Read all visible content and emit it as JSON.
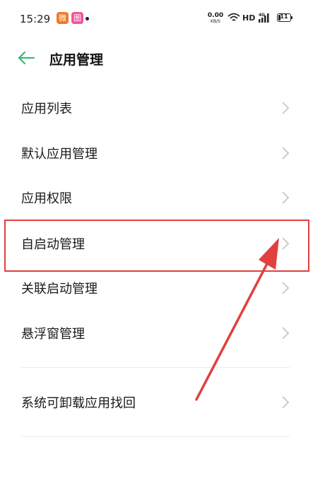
{
  "status_bar": {
    "time": "15:29",
    "app_icon_1": "微",
    "app_icon_2": "图",
    "net_speed_value": "0.00",
    "net_speed_unit": "KB/S",
    "hd": "HD",
    "signal_label": "4G",
    "battery": "11"
  },
  "header": {
    "title": "应用管理"
  },
  "menu": {
    "items": [
      {
        "label": "应用列表"
      },
      {
        "label": "默认应用管理"
      },
      {
        "label": "应用权限"
      },
      {
        "label": "自启动管理"
      },
      {
        "label": "关联启动管理"
      },
      {
        "label": "悬浮窗管理"
      },
      {
        "label": "系统可卸载应用找回"
      }
    ]
  },
  "colors": {
    "accent": "#2bb673",
    "highlight": "#e0403e",
    "chevron": "#c7c7c7"
  }
}
